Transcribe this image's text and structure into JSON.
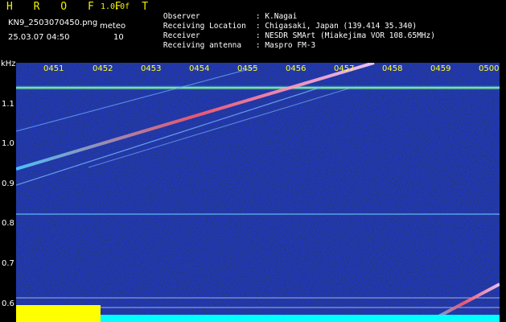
{
  "header": {
    "title": "H R O F F T",
    "version": "1.0.0f",
    "filename": "KN9_2503070450.png",
    "datetime": "25.03.07 04:50",
    "meteo_label": "meteo",
    "meteo_count": "10",
    "meta": [
      {
        "key": "Observer",
        "value": ": K.Nagai"
      },
      {
        "key": "Receiving Location",
        "value": ": Chigasaki, Japan (139.414 35.340)"
      },
      {
        "key": "Receiver",
        "value": ": NESDR SMArt (Miakejima VOR 108.65MHz)"
      },
      {
        "key": "Receiving antenna",
        "value": ": Maspro FM-3"
      }
    ]
  },
  "axis": {
    "y_unit": "kHz",
    "y_ticks": [
      "1.1",
      "1.0",
      "0.9",
      "0.8",
      "0.7",
      "0.6"
    ],
    "x_ticks": [
      "0451",
      "0452",
      "0453",
      "0454",
      "0455",
      "0456",
      "0457",
      "0458",
      "0459",
      "0500"
    ]
  },
  "colors": {
    "background": "#000000",
    "plot_bg": "#0a1470",
    "title": "#f0f000",
    "tick_labels_x": "#ffff30"
  }
}
